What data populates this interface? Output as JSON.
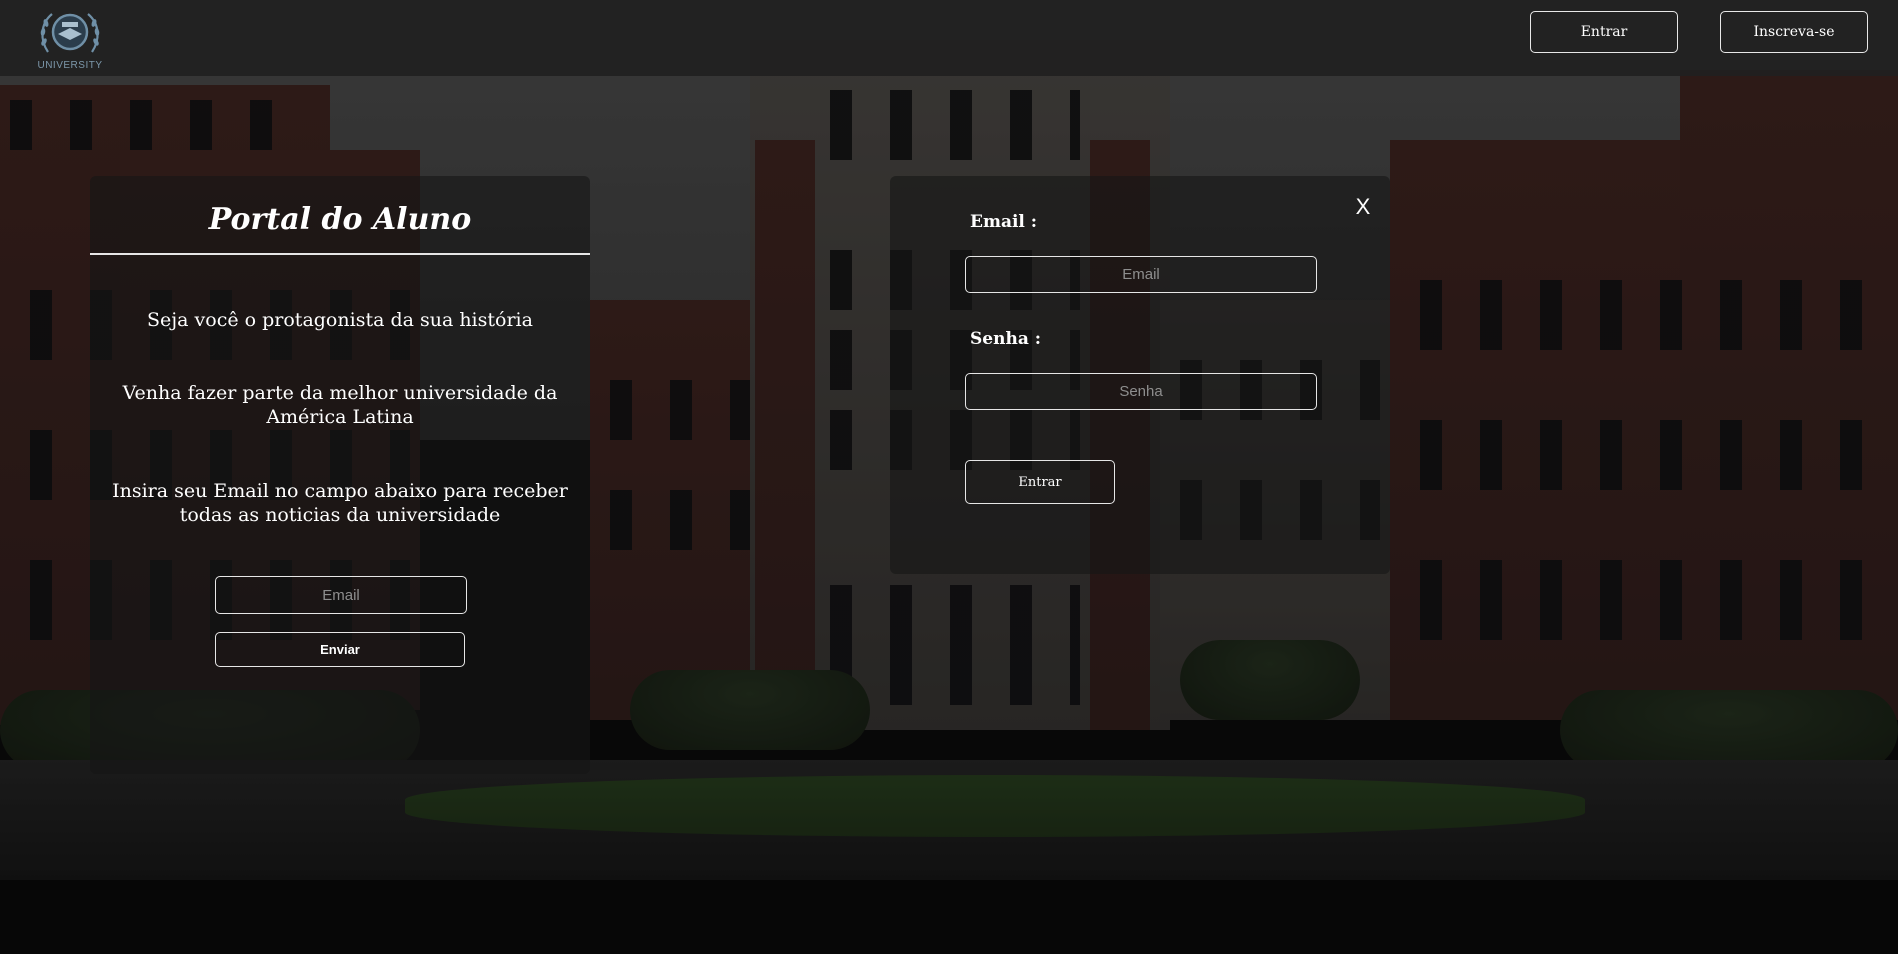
{
  "header": {
    "logo_text": "UNIVERSITY",
    "login_label": "Entrar",
    "signup_label": "Inscreva-se"
  },
  "left_panel": {
    "title": "Portal do Aluno",
    "tagline": "Seja você o protagonista da sua história",
    "invite": "Venha fazer parte da melhor universidade da América Latina",
    "instructions": "Insira seu Email no campo abaixo para receber todas as noticias da universidade",
    "email_placeholder": "Email",
    "submit_label": "Enviar"
  },
  "login_form": {
    "close_label": "X",
    "email_label": "Email :",
    "email_placeholder": "Email",
    "password_label": "Senha :",
    "password_placeholder": "Senha",
    "submit_label": "Entrar"
  },
  "colors": {
    "header_bg": "#202020",
    "panel_bg": "#161616",
    "border": "#e6e6e6",
    "text": "#ffffff",
    "placeholder": "#8e8e8e"
  }
}
